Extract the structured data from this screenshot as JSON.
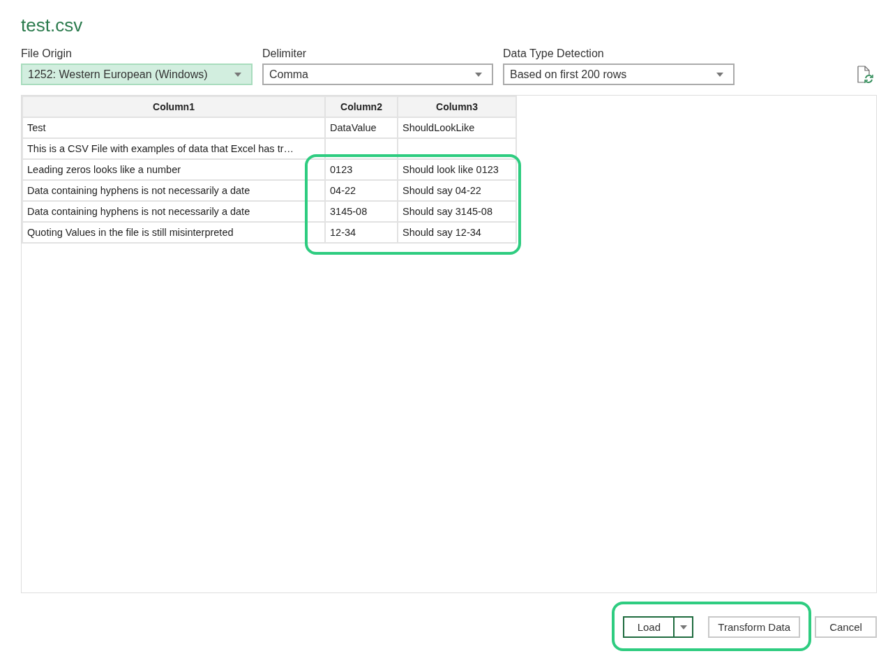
{
  "window": {
    "title": "test.csv"
  },
  "options": [
    {
      "label": "File Origin",
      "value": "1252: Western European (Windows)",
      "selected": true
    },
    {
      "label": "Delimiter",
      "value": "Comma",
      "selected": false
    },
    {
      "label": "Data Type Detection",
      "value": "Based on first 200 rows",
      "selected": false
    }
  ],
  "table": {
    "columns": [
      "Column1",
      "Column2",
      "Column3"
    ],
    "rows": [
      [
        "Test",
        "DataValue",
        "ShouldLookLike"
      ],
      [
        "This is a CSV File with examples of data that Excel has tr…",
        "",
        ""
      ],
      [
        "Leading zeros looks like a number",
        "0123",
        "Should look like 0123"
      ],
      [
        "Data containing hyphens is not necessarily a date",
        "04-22",
        "Should say 04-22"
      ],
      [
        "Data containing hyphens is not necessarily a date",
        "3145-08",
        "Should say 3145-08"
      ],
      [
        "Quoting Values in the file is still misinterpreted",
        "12-34",
        "Should say 12-34"
      ]
    ]
  },
  "buttons": {
    "load": "Load",
    "transform": "Transform Data",
    "cancel": "Cancel"
  }
}
